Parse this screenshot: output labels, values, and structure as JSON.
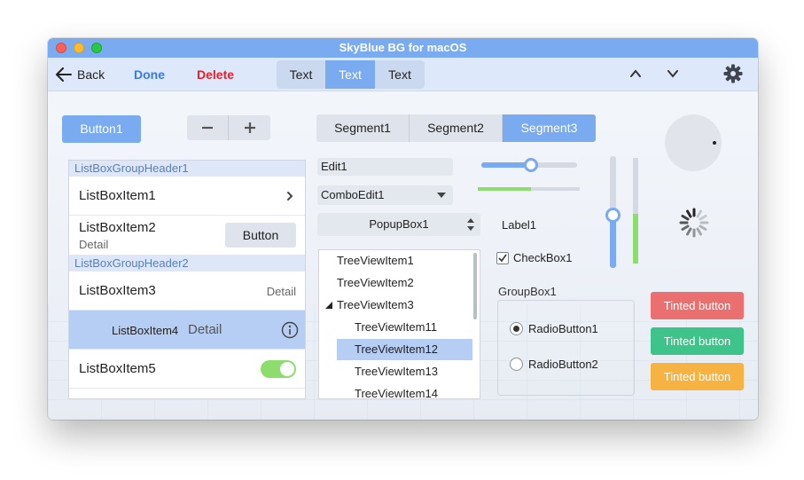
{
  "window": {
    "title": "SkyBlue BG for macOS",
    "colors": {
      "accent": "#7aaaf0",
      "toolbar": "#dde8fb",
      "destructive": "#e8202a",
      "progress": "#8ddc6e"
    }
  },
  "toolbar": {
    "back_label": "Back",
    "done_label": "Done",
    "delete_label": "Delete",
    "segments": [
      "Text",
      "Text",
      "Text"
    ],
    "selected_segment": 1,
    "icons": [
      "arrow-left-icon",
      "chevron-up-icon",
      "chevron-down-icon",
      "gear-icon"
    ]
  },
  "controls": {
    "button1_label": "Button1",
    "stepper_icons": [
      "minus-icon",
      "plus-icon"
    ],
    "segments": [
      "Segment1",
      "Segment2",
      "Segment3"
    ],
    "selected_segment": 2,
    "edit1_value": "Edit1",
    "combo_value": "ComboEdit1",
    "popup_value": "PopupBox1",
    "label1": "Label1",
    "checkbox_label": "CheckBox1",
    "checkbox_checked": true,
    "groupbox_title": "GroupBox1",
    "radio1_label": "RadioButton1",
    "radio2_label": "RadioButton2",
    "radio_selected": 1,
    "hslider_level": 0.52,
    "hprogress_level": 0.52,
    "vslider_level": 0.48,
    "vprogress_level": 0.47,
    "tinted_buttons": [
      {
        "label": "Tinted button",
        "color": "#eb6f6f"
      },
      {
        "label": "Tinted button",
        "color": "#3ec48a"
      },
      {
        "label": "Tinted button",
        "color": "#f7b342"
      }
    ]
  },
  "listbox": {
    "group_header1": "ListBoxGroupHeader1",
    "group_header2": "ListBoxGroupHeader2",
    "item1": "ListBoxItem1",
    "item2": "ListBoxItem2",
    "item2_detail": "Detail",
    "item2_button": "Button",
    "item3": "ListBoxItem3",
    "item3_detail": "Detail",
    "item4": "ListBoxItem4",
    "item4_detail": "Detail",
    "item5": "ListBoxItem5"
  },
  "tree": {
    "items": [
      "TreeViewItem1",
      "TreeViewItem2",
      "TreeViewItem3",
      "TreeViewItem11",
      "TreeViewItem12",
      "TreeViewItem13",
      "TreeViewItem14"
    ],
    "selected": "TreeViewItem12"
  }
}
